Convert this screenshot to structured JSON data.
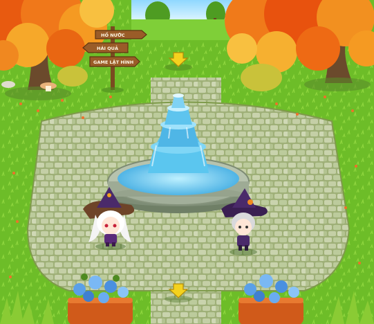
{
  "scene": {
    "signpost": {
      "signs": [
        {
          "label": "HỒ NƯỚC"
        },
        {
          "label": "HÁI QUẢ"
        },
        {
          "label": "GAME LẬT HÌNH"
        }
      ]
    },
    "exit_arrows": [
      {
        "direction": "down"
      },
      {
        "direction": "down"
      }
    ],
    "characters": [
      {
        "kind": "witch-girl-white-hair"
      },
      {
        "kind": "witch-boy-silver-hair"
      }
    ],
    "colors": {
      "grass": "#6fbf2a",
      "path_stone": "#b9c7a0",
      "water": "#58c8f0",
      "autumn_leaves": "#f06a14",
      "arrow": "#f4d21e",
      "sign_wood": "#9a5c28"
    }
  }
}
